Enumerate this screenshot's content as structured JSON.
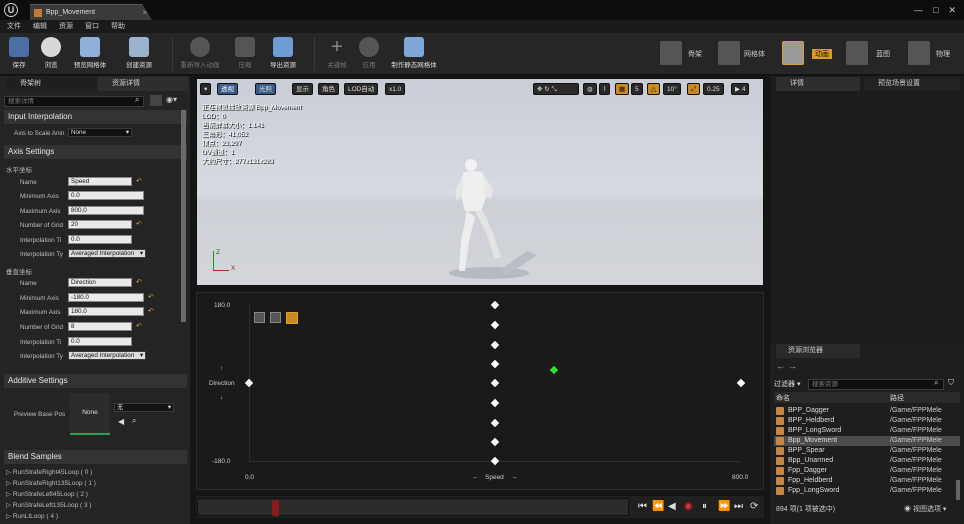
{
  "window": {
    "tab_title": "Bpp_Movement",
    "controls": [
      "—",
      "□",
      "✕"
    ]
  },
  "menu": [
    "文件",
    "编辑",
    "资源",
    "窗口",
    "帮助"
  ],
  "toolbar": {
    "buttons": [
      "保存",
      "浏览",
      "预览网格体",
      "创建资源",
      "重新导入动画",
      "压缩",
      "导出资源",
      "关键帧",
      "应用",
      "制作静态网格体"
    ],
    "modes": [
      "骨架",
      "网格体",
      "动画",
      "蓝图",
      "物理"
    ]
  },
  "left_panel": {
    "tabs": [
      "骨架树",
      "资源详情"
    ],
    "search_placeholder": "搜索详情",
    "input_interpolation": {
      "title": "Input Interpolation",
      "axis_to_scale_label": "Axis to Scale Anin",
      "axis_to_scale_value": "None"
    },
    "axis_settings": {
      "title": "Axis Settings",
      "horizontal": {
        "header": "水平坐标",
        "name_label": "Name",
        "name": "Speed",
        "min_label": "Minimum Axis",
        "min": "0.0",
        "max_label": "Maximum Axis",
        "max": "800.0",
        "grid_label": "Number of Grid",
        "grid": "20",
        "interp_time_label": "Interpolation Ti",
        "interp_time": "0.0",
        "interp_type_label": "Interpolation Ty",
        "interp_type": "Averaged Interpolation"
      },
      "vertical": {
        "header": "垂直坐标",
        "name_label": "Name",
        "name": "Direction",
        "min_label": "Minimum Axis",
        "min": "-180.0",
        "max_label": "Maximum Axis",
        "max": "180.0",
        "grid_label": "Number of Grid",
        "grid": "8",
        "interp_time_label": "Interpolation Ti",
        "interp_time": "0.0",
        "interp_type_label": "Interpolation Ty",
        "interp_type": "Averaged Interpolation"
      }
    },
    "additive_settings": {
      "title": "Additive Settings",
      "preview_label": "Preview Base Pos",
      "preview_thumb": "None",
      "preview_select": "无"
    },
    "blend_samples": {
      "title": "Blend Samples",
      "items": [
        "RunStrafeRight45Loop ( 0 )",
        "RunStrafeRight135Loop ( 1 )",
        "RunStrafeLeft45Loop ( 2 )",
        "RunStrafeLeft135Loop ( 3 )",
        "RunLtLoop ( 4 )"
      ]
    }
  },
  "viewport": {
    "buttons": {
      "perspective": "透视",
      "lit": "光照",
      "show": "显示",
      "character": "角色",
      "lod": "LOD自动",
      "speed": "x1.0"
    },
    "right_controls": {
      "grid_size": "5",
      "rot_snap": "10°",
      "scale_snap": "0.25",
      "cam_speed": "4"
    },
    "info": [
      "正在预览播放资源 Bpp_Movement",
      "LOD：0",
      "当前屏幕大小：1.141",
      "三角形：41,052",
      "顶点：23,297",
      "UV通道：1",
      "大约尺寸：277x131x283"
    ],
    "axis": {
      "z": "Z",
      "x": "X"
    }
  },
  "blendspace": {
    "y_max": "180.0",
    "y_min": "-180.0",
    "x_min": "0.0",
    "x_max": "800.0",
    "y_axis_name": "Direction",
    "x_axis_name": "Speed",
    "up_arrow": "↑",
    "down_arrow": "↓",
    "left_arrow": "←",
    "right_arrow": "→"
  },
  "details_panel": {
    "tabs": [
      "详情",
      "预览场景设置"
    ]
  },
  "content_browser": {
    "title": "资源浏览器",
    "filter_label": "过滤器",
    "search_placeholder": "搜索资源",
    "col_name": "命名",
    "col_path": "路径",
    "rows": [
      {
        "name": "BPP_Dagger",
        "path": "/Game/FPPMele"
      },
      {
        "name": "BPP_Heldberd",
        "path": "/Game/FPPMele"
      },
      {
        "name": "BPP_LongSword",
        "path": "/Game/FPPMele"
      },
      {
        "name": "Bpp_Movement",
        "path": "/Game/FPPMele"
      },
      {
        "name": "BPP_Spear",
        "path": "/Game/FPPMele"
      },
      {
        "name": "Bpp_Unarmed",
        "path": "/Game/FPPMele"
      },
      {
        "name": "Fpp_Dagger",
        "path": "/Game/FPPMele"
      },
      {
        "name": "Fpp_Heldberd",
        "path": "/Game/FPPMele"
      },
      {
        "name": "Fpp_LongSword",
        "path": "/Game/FPPMele"
      }
    ],
    "status": "894 项(1 项被选中)",
    "view_options": "视图选项"
  }
}
